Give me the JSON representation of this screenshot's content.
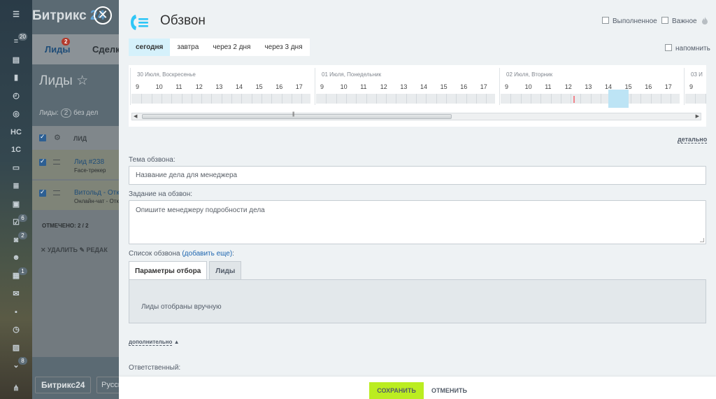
{
  "background_app": {
    "logo_text": "Битрикс",
    "logo_num": "24",
    "tabs": [
      {
        "label": "Лиды",
        "badge": "2"
      },
      {
        "label": "Сделки",
        "badge": ""
      }
    ],
    "page_title": "Лиды ☆",
    "leads_count_prefix": "Лиды:",
    "leads_count": "2",
    "leads_count_suffix": "без дел",
    "table_header": "ЛИД",
    "rows": [
      {
        "title": "Лид #238",
        "subtitle": "Face-трекер"
      },
      {
        "title": "Витольд - Откр",
        "subtitle": "Онлайн-чат - Откр"
      }
    ],
    "selected_text": "ОТМЕЧЕНО: 2 / 2",
    "actions": "✕ УДАЛИТЬ    ✎ РЕДАК",
    "footer_logo": "Битрикс24",
    "footer_lang": "Русск",
    "rail_badges": [
      "20",
      "6",
      "2",
      "1",
      "8"
    ],
    "rail_text": "НС"
  },
  "panel": {
    "title": "Обзвон",
    "done_label": "Выполненное",
    "important_label": "Важное",
    "day_tabs": [
      "сегодня",
      "завтра",
      "через 2 дня",
      "через 3 дня"
    ],
    "active_day": 0,
    "remind_label": "напомнить",
    "timeline": {
      "days": [
        "30 Июля, Воскресенье",
        "01 Июля, Понедельник",
        "02 Июля, Вторник",
        "03 И"
      ],
      "hours": [
        "9",
        "10",
        "11",
        "12",
        "13",
        "14",
        "15",
        "16",
        "17"
      ],
      "selected_hour": "15"
    },
    "detail_link": "детально",
    "subject_label": "Тема обзвона:",
    "subject_placeholder": "Название дела для менеджера",
    "task_label": "Задание на обзвон:",
    "task_placeholder": "Опишите менеджеру подробности дела",
    "list_label": "Список обзвона",
    "list_add_link": "(добавить еще)",
    "list_colon": ":",
    "list_tabs": [
      "Параметры отбора",
      "Лиды"
    ],
    "list_body_text": "Лиды отобраны вручную",
    "more_link": "дополнительно",
    "responsible_label": "Ответственный:",
    "save_label": "СОХРАНИТЬ",
    "cancel_label": "ОТМЕНИТЬ"
  },
  "colors": {
    "accent_blue": "#2fc6f6",
    "save_green": "#bbed21",
    "active_tab": "#d5f1fb"
  }
}
